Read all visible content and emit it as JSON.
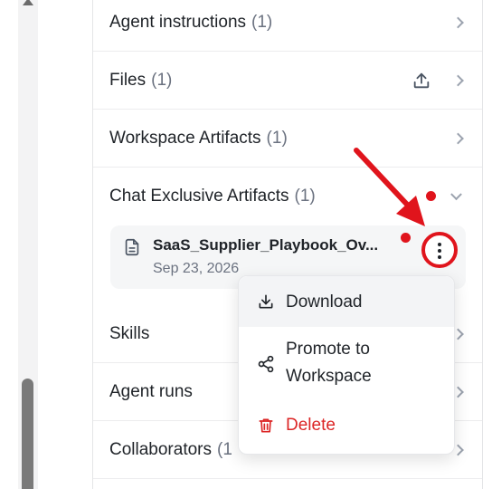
{
  "sections": [
    {
      "label": "Agent instructions",
      "count": "(1)",
      "icon": "chevron-right-icon"
    },
    {
      "label": "Files",
      "count": "(1)",
      "icon": "chevron-right-icon",
      "action_icon": "upload-icon"
    },
    {
      "label": "Workspace Artifacts",
      "count": "(1)",
      "icon": "chevron-right-icon"
    },
    {
      "label": "Chat Exclusive Artifacts",
      "count": "(1)",
      "icon": "chevron-down-icon"
    },
    {
      "label": "Skills",
      "count": "",
      "icon": "chevron-right-icon"
    },
    {
      "label": "Agent runs",
      "count": "",
      "icon": "chevron-right-icon"
    },
    {
      "label": "Collaborators",
      "count": "(1",
      "icon": "chevron-right-icon"
    }
  ],
  "file": {
    "name": "SaaS_Supplier_Playbook_Ov...",
    "date": "Sep 23, 2026",
    "icon": "document-icon",
    "more_icon": "more-vertical-icon"
  },
  "context_menu": {
    "items": [
      {
        "label": "Download",
        "icon": "download-icon"
      },
      {
        "label_line1": "Promote to",
        "label_line2": "Workspace",
        "icon": "share-icon"
      },
      {
        "label": "Delete",
        "icon": "trash-icon"
      }
    ]
  },
  "colors": {
    "annotation_red": "#e0141c",
    "danger": "#dc2626",
    "muted": "#6b7280"
  }
}
